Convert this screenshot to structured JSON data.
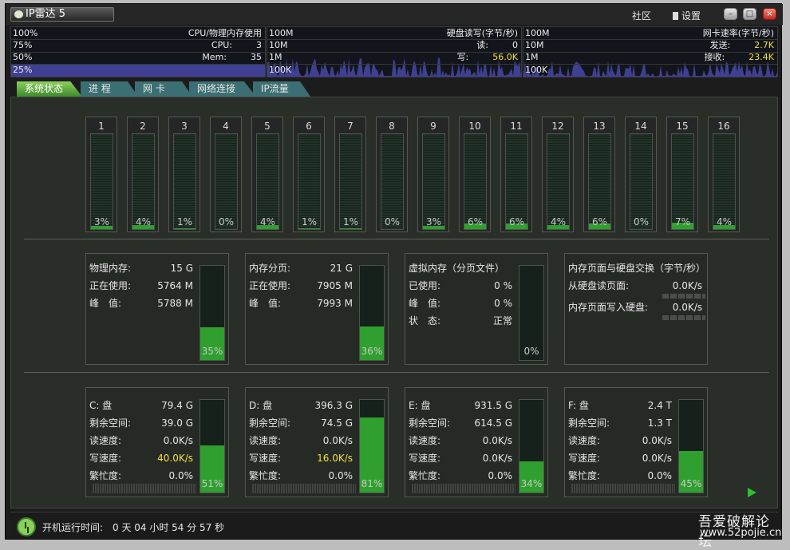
{
  "window": {
    "title": "IP雷达 5",
    "menu": {
      "community": "社区",
      "settings": "设置"
    },
    "controls": {
      "minimize": "–",
      "maximize": "□",
      "close": "×"
    }
  },
  "monitor": {
    "cpu": {
      "title": "CPU/物理内存使用",
      "scale": [
        "100%",
        "75%",
        "50%",
        "25%"
      ],
      "cpu_label": "CPU:",
      "cpu_value": "3",
      "mem_label": "Mem:",
      "mem_value": "35"
    },
    "disk": {
      "title": "硬盘读写(字节/秒)",
      "scale": [
        "100M",
        "10M",
        "1M",
        "100K"
      ],
      "read_label": "读:",
      "read_value": "0",
      "write_label": "写:",
      "write_value": "56.0K"
    },
    "net": {
      "title": "网卡速率(字节/秒)",
      "scale": [
        "100M",
        "10M",
        "1M",
        "100K"
      ],
      "send_label": "发送:",
      "send_value": "2.7K",
      "recv_label": "接收:",
      "recv_value": "23.4K"
    }
  },
  "tabs": [
    {
      "label": "系统状态",
      "active": true
    },
    {
      "label": "进 程",
      "active": false
    },
    {
      "label": "网 卡",
      "active": false
    },
    {
      "label": "网络连接",
      "active": false
    },
    {
      "label": "IP流量",
      "active": false
    }
  ],
  "cores": [
    {
      "label": "1",
      "usage": "3%",
      "level": 3
    },
    {
      "label": "2",
      "usage": "4%",
      "level": 4
    },
    {
      "label": "3",
      "usage": "1%",
      "level": 1
    },
    {
      "label": "4",
      "usage": "0%",
      "level": 0
    },
    {
      "label": "5",
      "usage": "4%",
      "level": 4
    },
    {
      "label": "6",
      "usage": "1%",
      "level": 1
    },
    {
      "label": "7",
      "usage": "1%",
      "level": 1
    },
    {
      "label": "8",
      "usage": "0%",
      "level": 0
    },
    {
      "label": "9",
      "usage": "3%",
      "level": 3
    },
    {
      "label": "10",
      "usage": "6%",
      "level": 6
    },
    {
      "label": "11",
      "usage": "6%",
      "level": 6
    },
    {
      "label": "12",
      "usage": "4%",
      "level": 4
    },
    {
      "label": "13",
      "usage": "6%",
      "level": 6
    },
    {
      "label": "14",
      "usage": "0%",
      "level": 0
    },
    {
      "label": "15",
      "usage": "7%",
      "level": 7
    },
    {
      "label": "16",
      "usage": "4%",
      "level": 4
    }
  ],
  "memory": {
    "physical": {
      "rows": [
        [
          "物理内存:",
          "15 G"
        ],
        [
          "正在使用:",
          "5764 M"
        ],
        [
          "峰　值:",
          "5788 M"
        ]
      ],
      "usage": "35%",
      "level": 35
    },
    "paged": {
      "rows": [
        [
          "内存分页:",
          "21 G"
        ],
        [
          "正在使用:",
          "7905 M"
        ],
        [
          "峰　值:",
          "7993 M"
        ]
      ],
      "usage": "36%",
      "level": 36
    },
    "virtual": {
      "title": "虚拟内存（分页文件）",
      "rows": [
        [
          "已使用:",
          "0 %"
        ],
        [
          "峰　值:",
          "0 %"
        ],
        [
          "状　态:",
          "正常"
        ]
      ],
      "usage": "0%",
      "level": 0
    },
    "paging": {
      "title": "内存页面与硬盘交换（字节/秒）",
      "rows": [
        [
          "从硬盘读页面:",
          "0.0K/s"
        ],
        [
          "内存页面写入硬盘:",
          "0.0K/s"
        ]
      ]
    }
  },
  "disks": [
    {
      "name": "C: 盘",
      "size": "79.4 G",
      "free_label": "剩余空间:",
      "free": "39.0 G",
      "read_label": "读速度:",
      "read": "0.0K/s",
      "write_label": "写速度:",
      "write": "40.0K/s",
      "write_highlight": true,
      "busy_label": "繁忙度:",
      "busy": "0.0%",
      "usage": "51%",
      "level": 51
    },
    {
      "name": "D: 盘",
      "size": "396.3 G",
      "free_label": "剩余空间:",
      "free": "74.5 G",
      "read_label": "读速度:",
      "read": "0.0K/s",
      "write_label": "写速度:",
      "write": "16.0K/s",
      "write_highlight": true,
      "busy_label": "繁忙度:",
      "busy": "0.0%",
      "usage": "81%",
      "level": 81
    },
    {
      "name": "E: 盘",
      "size": "931.5 G",
      "free_label": "剩余空间:",
      "free": "614.5 G",
      "read_label": "读速度:",
      "read": "0.0K/s",
      "write_label": "写速度:",
      "write": "0.0K/s",
      "write_highlight": false,
      "busy_label": "繁忙度:",
      "busy": "0.0%",
      "usage": "34%",
      "level": 34
    },
    {
      "name": "F: 盘",
      "size": "2.4 T",
      "free_label": "剩余空间:",
      "free": "1.3 T",
      "read_label": "读速度:",
      "read": "0.0K/s",
      "write_label": "写速度:",
      "write": "0.0K/s",
      "write_highlight": false,
      "busy_label": "繁忙度:",
      "busy": "0.0%",
      "usage": "45%",
      "level": 45
    }
  ],
  "status": {
    "label": "开机运行时间:",
    "value": "0 天 04 小时 54 分 57 秒"
  },
  "watermark": {
    "line1": "吾爱破解论坛",
    "line2": "www.52pojie.cn"
  },
  "colors": {
    "bar_fill": "#2fa02f",
    "cpu_graph": "#3f3f93",
    "highlight": "#f0e040",
    "panel_bg": "#262a25"
  }
}
